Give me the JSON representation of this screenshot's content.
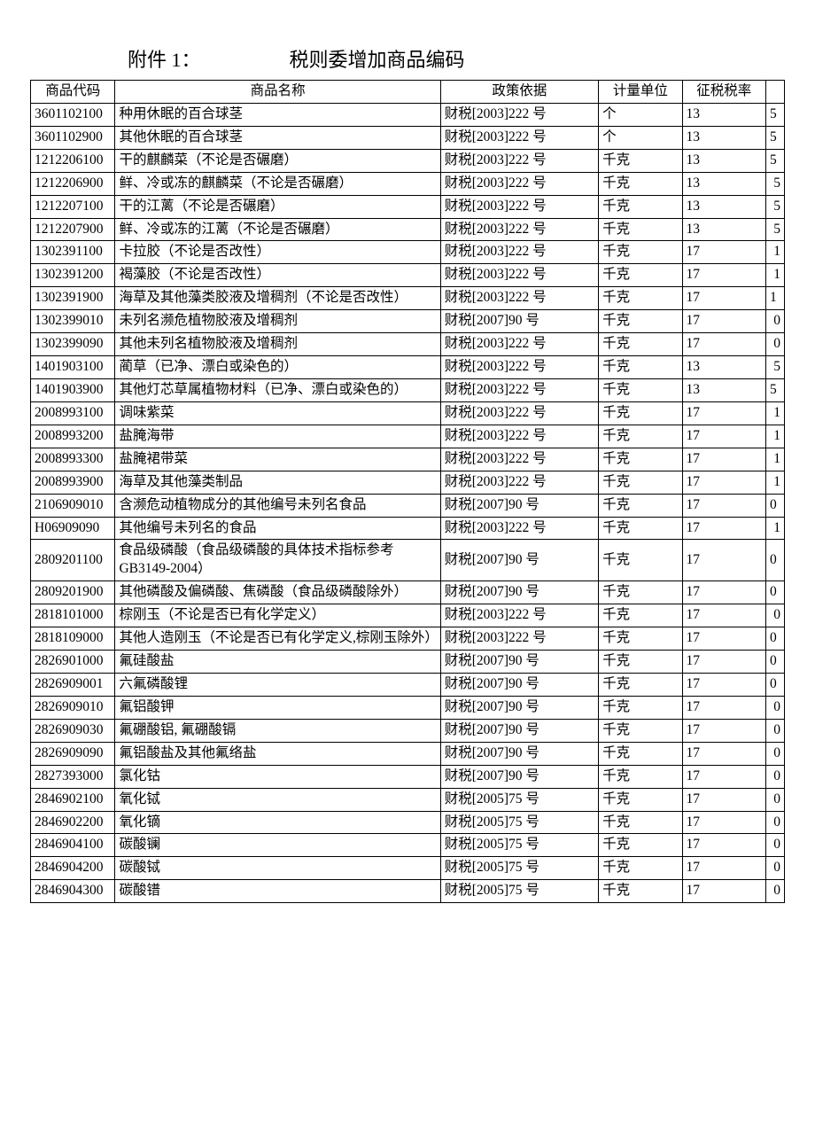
{
  "attachment_label": "附件 1：",
  "title": "税则委增加商品编码",
  "headers": {
    "code": "商品代码",
    "name": "商品名称",
    "basis": "政策依据",
    "unit": "计量单位",
    "rate": "征税税率",
    "extra": ""
  },
  "rows": [
    {
      "code": "3601102100",
      "name": "种用休眠的百合球茎",
      "basis": "财税[2003]222 号",
      "unit": "个",
      "rate": "13",
      "extra": "5",
      "align": "l"
    },
    {
      "code": "3601102900",
      "name": "其他休眠的百合球茎",
      "basis": "财税[2003]222 号",
      "unit": "个",
      "rate": "13",
      "extra": "5",
      "align": "l"
    },
    {
      "code": "1212206100",
      "name": "干的麒麟菜（不论是否碾磨）",
      "basis": "财税[2003]222 号",
      "unit": "千克",
      "rate": "13",
      "extra": "5",
      "align": "l"
    },
    {
      "code": "1212206900",
      "name": "鲜、冷或冻的麒麟菜（不论是否碾磨）",
      "basis": "财税[2003]222 号",
      "unit": "千克",
      "rate": "13",
      "extra": "5",
      "align": "r"
    },
    {
      "code": "1212207100",
      "name": "干的江蓠（不论是否碾磨）",
      "basis": "财税[2003]222 号",
      "unit": "千克",
      "rate": "13",
      "extra": "5",
      "align": "r"
    },
    {
      "code": "1212207900",
      "name": "鲜、冷或冻的江蓠（不论是否碾磨）",
      "basis": "财税[2003]222 号",
      "unit": "千克",
      "rate": "13",
      "extra": "5",
      "align": "r"
    },
    {
      "code": "1302391100",
      "name": "卡拉胶（不论是否改性）",
      "basis": "财税[2003]222 号",
      "unit": "千克",
      "rate": "17",
      "extra": "1",
      "align": "r"
    },
    {
      "code": "1302391200",
      "name": "褐藻胶（不论是否改性）",
      "basis": "财税[2003]222 号",
      "unit": "千克",
      "rate": "17",
      "extra": "1",
      "align": "r"
    },
    {
      "code": "1302391900",
      "name": "海草及其他藻类胶液及增稠剂（不论是否改性）",
      "basis": "财税[2003]222 号",
      "unit": "千克",
      "rate": "17",
      "extra": "1",
      "align": "l"
    },
    {
      "code": "1302399010",
      "name": "未列名濒危植物胶液及增稠剂",
      "basis": "财税[2007]90 号",
      "unit": "千克",
      "rate": "17",
      "extra": "0",
      "align": "r"
    },
    {
      "code": "1302399090",
      "name": "其他未列名植物胶液及增稠剂",
      "basis": "财税[2003]222 号",
      "unit": "千克",
      "rate": "17",
      "extra": "0",
      "align": "r"
    },
    {
      "code": "1401903100",
      "name": "蔺草（已净、漂白或染色的）",
      "basis": "财税[2003]222 号",
      "unit": "千克",
      "rate": "13",
      "extra": "5",
      "align": "r"
    },
    {
      "code": "1401903900",
      "name": "其他灯芯草属植物材料（已净、漂白或染色的）",
      "basis": "财税[2003]222 号",
      "unit": "千克",
      "rate": "13",
      "extra": "5",
      "align": "l"
    },
    {
      "code": "2008993100",
      "name": "调味紫菜",
      "basis": "财税[2003]222 号",
      "unit": "千克",
      "rate": "17",
      "extra": "1",
      "align": "r"
    },
    {
      "code": "2008993200",
      "name": "盐腌海带",
      "basis": "财税[2003]222 号",
      "unit": "千克",
      "rate": "17",
      "extra": "1",
      "align": "r"
    },
    {
      "code": "2008993300",
      "name": "盐腌裙带菜",
      "basis": "财税[2003]222 号",
      "unit": "千克",
      "rate": "17",
      "extra": "1",
      "align": "r"
    },
    {
      "code": "2008993900",
      "name": "海草及其他藻类制品",
      "basis": "财税[2003]222 号",
      "unit": "千克",
      "rate": "17",
      "extra": "1",
      "align": "r"
    },
    {
      "code": "2106909010",
      "name": "含濒危动植物成分的其他编号未列名食品",
      "basis": "财税[2007]90 号",
      "unit": "千克",
      "rate": "17",
      "extra": "0",
      "align": "l"
    },
    {
      "code": "H06909090",
      "name": "其他编号未列名的食品",
      "basis": "财税[2003]222 号",
      "unit": "千克",
      "rate": "17",
      "extra": "1",
      "align": "r"
    },
    {
      "code": "2809201100",
      "name": "食品级磷酸（食品级磷酸的具体技术指标参考GB3149-2004）",
      "basis": "财税[2007]90 号",
      "unit": "千克",
      "rate": "17",
      "extra": "0",
      "align": "l"
    },
    {
      "code": "2809201900",
      "name": "其他磷酸及偏磷酸、焦磷酸（食品级磷酸除外）",
      "basis": "财税[2007]90 号",
      "unit": "千克",
      "rate": "17",
      "extra": "0",
      "align": "l"
    },
    {
      "code": "2818101000",
      "name": "棕刚玉（不论是否已有化学定义）",
      "basis": "财税[2003]222 号",
      "unit": "千克",
      "rate": "17",
      "extra": "0",
      "align": "r"
    },
    {
      "code": "2818109000",
      "name": "其他人造刚玉（不论是否已有化学定义,棕刚玉除外）",
      "basis": "财税[2003]222 号",
      "unit": "千克",
      "rate": "17",
      "extra": "0",
      "align": "l"
    },
    {
      "code": "2826901000",
      "name": "氟硅酸盐",
      "basis": "财税[2007]90 号",
      "unit": "千克",
      "rate": "17",
      "extra": "0",
      "align": "l"
    },
    {
      "code": "2826909001",
      "name": "六氟磷酸锂",
      "basis": "财税[2007]90 号",
      "unit": "千克",
      "rate": "17",
      "extra": "0",
      "align": "l"
    },
    {
      "code": "2826909010",
      "name": "氟铝酸钾",
      "basis": "财税[2007]90 号",
      "unit": "千克",
      "rate": "17",
      "extra": "0",
      "align": "r"
    },
    {
      "code": "2826909030",
      "name": "氟硼酸铝, 氟硼酸镉",
      "basis": "财税[2007]90 号",
      "unit": "千克",
      "rate": "17",
      "extra": "0",
      "align": "r"
    },
    {
      "code": "2826909090",
      "name": "氟铝酸盐及其他氟络盐",
      "basis": "财税[2007]90 号",
      "unit": "千克",
      "rate": "17",
      "extra": "0",
      "align": "r"
    },
    {
      "code": "2827393000",
      "name": "氯化钴",
      "basis": "财税[2007]90 号",
      "unit": "千克",
      "rate": "17",
      "extra": "0",
      "align": "r"
    },
    {
      "code": "2846902100",
      "name": "氧化铽",
      "basis": "财税[2005]75 号",
      "unit": "千克",
      "rate": "17",
      "extra": "0",
      "align": "r"
    },
    {
      "code": "2846902200",
      "name": "氧化镝",
      "basis": "财税[2005]75 号",
      "unit": "千克",
      "rate": "17",
      "extra": "0",
      "align": "r"
    },
    {
      "code": "2846904100",
      "name": "碳酸镧",
      "basis": "财税[2005]75 号",
      "unit": "千克",
      "rate": "17",
      "extra": "0",
      "align": "r"
    },
    {
      "code": "2846904200",
      "name": "碳酸铽",
      "basis": "财税[2005]75 号",
      "unit": "千克",
      "rate": "17",
      "extra": "0",
      "align": "r"
    },
    {
      "code": "2846904300",
      "name": "碳酸镨",
      "basis": "财税[2005]75 号",
      "unit": "千克",
      "rate": "17",
      "extra": "0",
      "align": "r"
    }
  ]
}
